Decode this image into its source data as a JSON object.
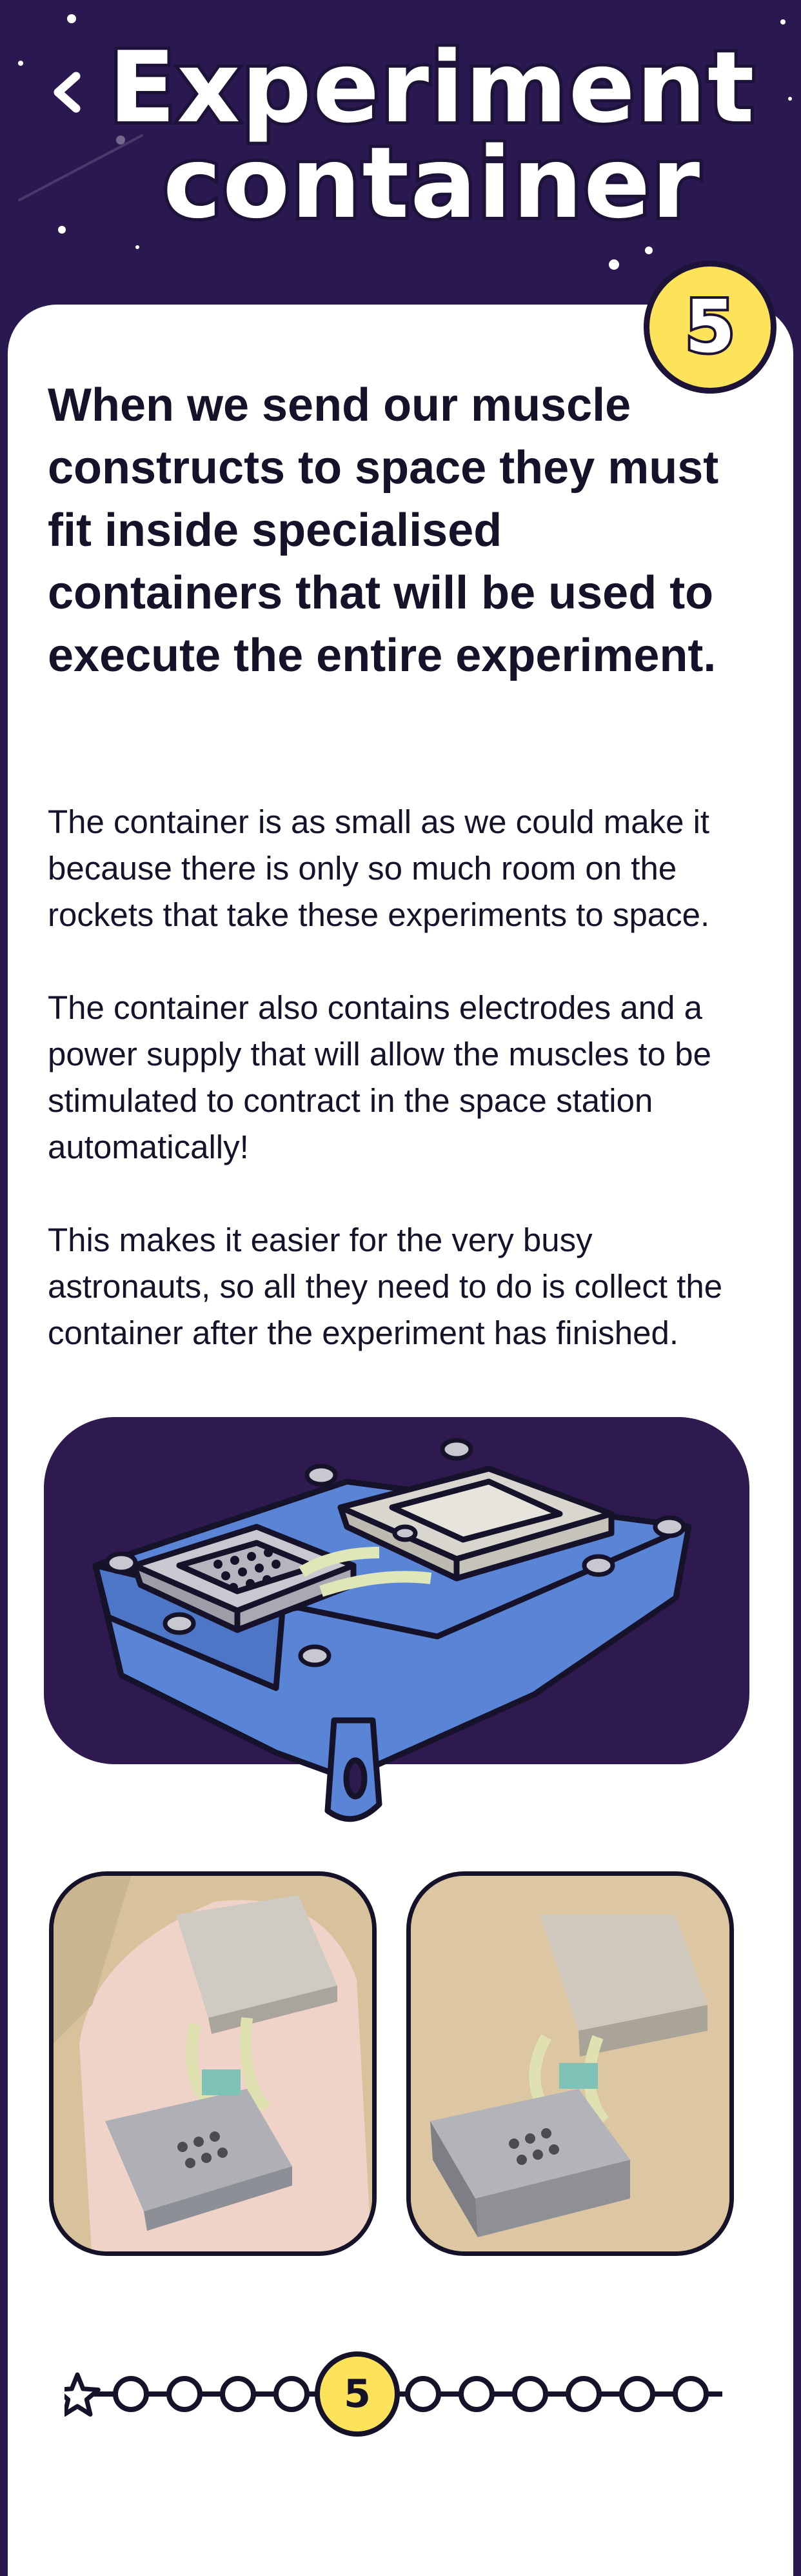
{
  "header": {
    "title_line1": "Experiment",
    "title_line2": "container",
    "back_icon": "chevron-left-icon",
    "background_color": "#2a1850"
  },
  "page_number": "5",
  "content": {
    "lead": "When we send our muscle constructs to space they must fit inside specialised containers that will be used to execute the entire experiment.",
    "paragraphs": [
      "The container is as small as we could make it because there is only so much room on the rockets that take these experiments to space.",
      "The container also contains electrodes and a power supply that will allow the muscles to be stimulated to contract in the space station automatically!",
      "This makes it easier for the very busy astronauts, so all they need to do is collect the container after the experiment has finished."
    ]
  },
  "illustration": {
    "icon": "experiment-container-illustration",
    "background_color": "#2e1a4f",
    "body_color": "#5a85d6"
  },
  "photos": [
    {
      "icon": "container-in-hand-photo"
    },
    {
      "icon": "container-on-table-photo"
    }
  ],
  "progress": {
    "start_icon": "star-icon",
    "current": "5",
    "total_steps": 13,
    "current_index": 5,
    "accent_color": "#fde35a"
  }
}
